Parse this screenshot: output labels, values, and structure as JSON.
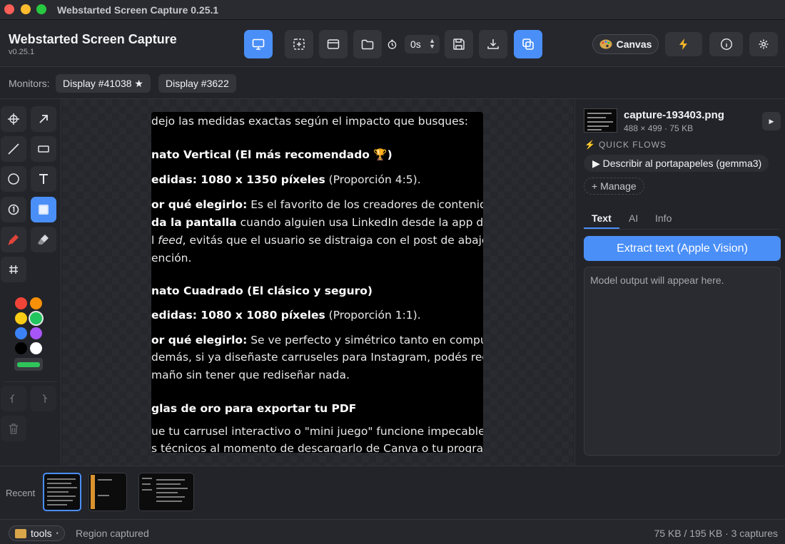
{
  "window": {
    "title": "Webstarted Screen Capture 0.25.1"
  },
  "header": {
    "app_title": "Webstarted Screen Capture",
    "version": "v0.25.1",
    "timer_value": "0s",
    "canvas_label": "Canvas",
    "toolbar_icons": [
      "monitor-icon",
      "region-select-icon",
      "window-icon",
      "folder-icon",
      "save-icon",
      "download-icon",
      "copy-icon"
    ],
    "accent": "#4a8ff7"
  },
  "monitors": {
    "label": "Monitors:",
    "displays": [
      {
        "label": "Display #41038 ★",
        "starred": true
      },
      {
        "label": "Display #3622",
        "starred": false
      }
    ]
  },
  "tools": {
    "icons": [
      "crosshair-icon",
      "arrow-icon",
      "line-icon",
      "rectangle-icon",
      "ellipse-icon",
      "text-icon",
      "counter-icon",
      "blur-icon",
      "marker-icon",
      "eraser-icon",
      "grid-icon",
      "undo-icon",
      "redo-icon",
      "trash-icon"
    ],
    "colors": [
      "#f04438",
      "#f79009",
      "#facc15",
      "#22c55e",
      "#3b82f6",
      "#a855f7",
      "#000000",
      "#ffffff"
    ],
    "selected_color": "#22c55e"
  },
  "capture_text": {
    "l1": "dejo las medidas exactas según el impacto que busques:",
    "l2": "nato Vertical (El más recomendado 🏆)",
    "l3a": "edidas: 1080 x 1350 píxeles",
    "l3b": " (Proporción 4:5).",
    "l4a": "or qué elegirlo:",
    "l4b": " Es el favorito de los creadores de contenido. ¿La raz",
    "l5a": "da la pantalla",
    "l5b": " cuando alguien usa LinkedIn desde la app del celular",
    "l6a": "l ",
    "l6b": "feed",
    "l6c": ", evitás que el usuario se distraiga con el post de abajo y retie",
    "l7": "ención.",
    "l8": "nato Cuadrado (El clásico y seguro)",
    "l9a": "edidas: 1080 x 1080 píxeles",
    "l9b": " (Proporción 1:1).",
    "l10a": "or qué elegirlo:",
    "l10b": " Se ve perfecto y simétrico tanto en computadora co",
    "l11": "demás, si ya diseñaste carruseles para Instagram, podés reciclar exa",
    "l12": "maño sin tener que rediseñar nada.",
    "l13": "glas de oro para exportar tu PDF",
    "l14": "ue tu carrusel interactivo o \"mini juego\" funcione impecable, tené er",
    "l15": "s técnicos al momento de descargarlo de Canva o tu programa de d"
  },
  "details": {
    "filename": "capture-193403.png",
    "meta": "488 × 499 · 75 KB",
    "quick_flows_title": "QUICK FLOWS",
    "flow_label": "▶ Describir al portapapeles (gemma3)",
    "manage_label": "+ Manage",
    "tabs": [
      "Text",
      "AI",
      "Info"
    ],
    "active_tab": "Text",
    "extract_label": "Extract text (Apple Vision)",
    "output_placeholder": "Model output will appear here."
  },
  "recent": {
    "label": "Recent"
  },
  "status": {
    "folder": "tools",
    "message": "Region captured",
    "summary": "75 KB / 195 KB · 3 captures"
  }
}
